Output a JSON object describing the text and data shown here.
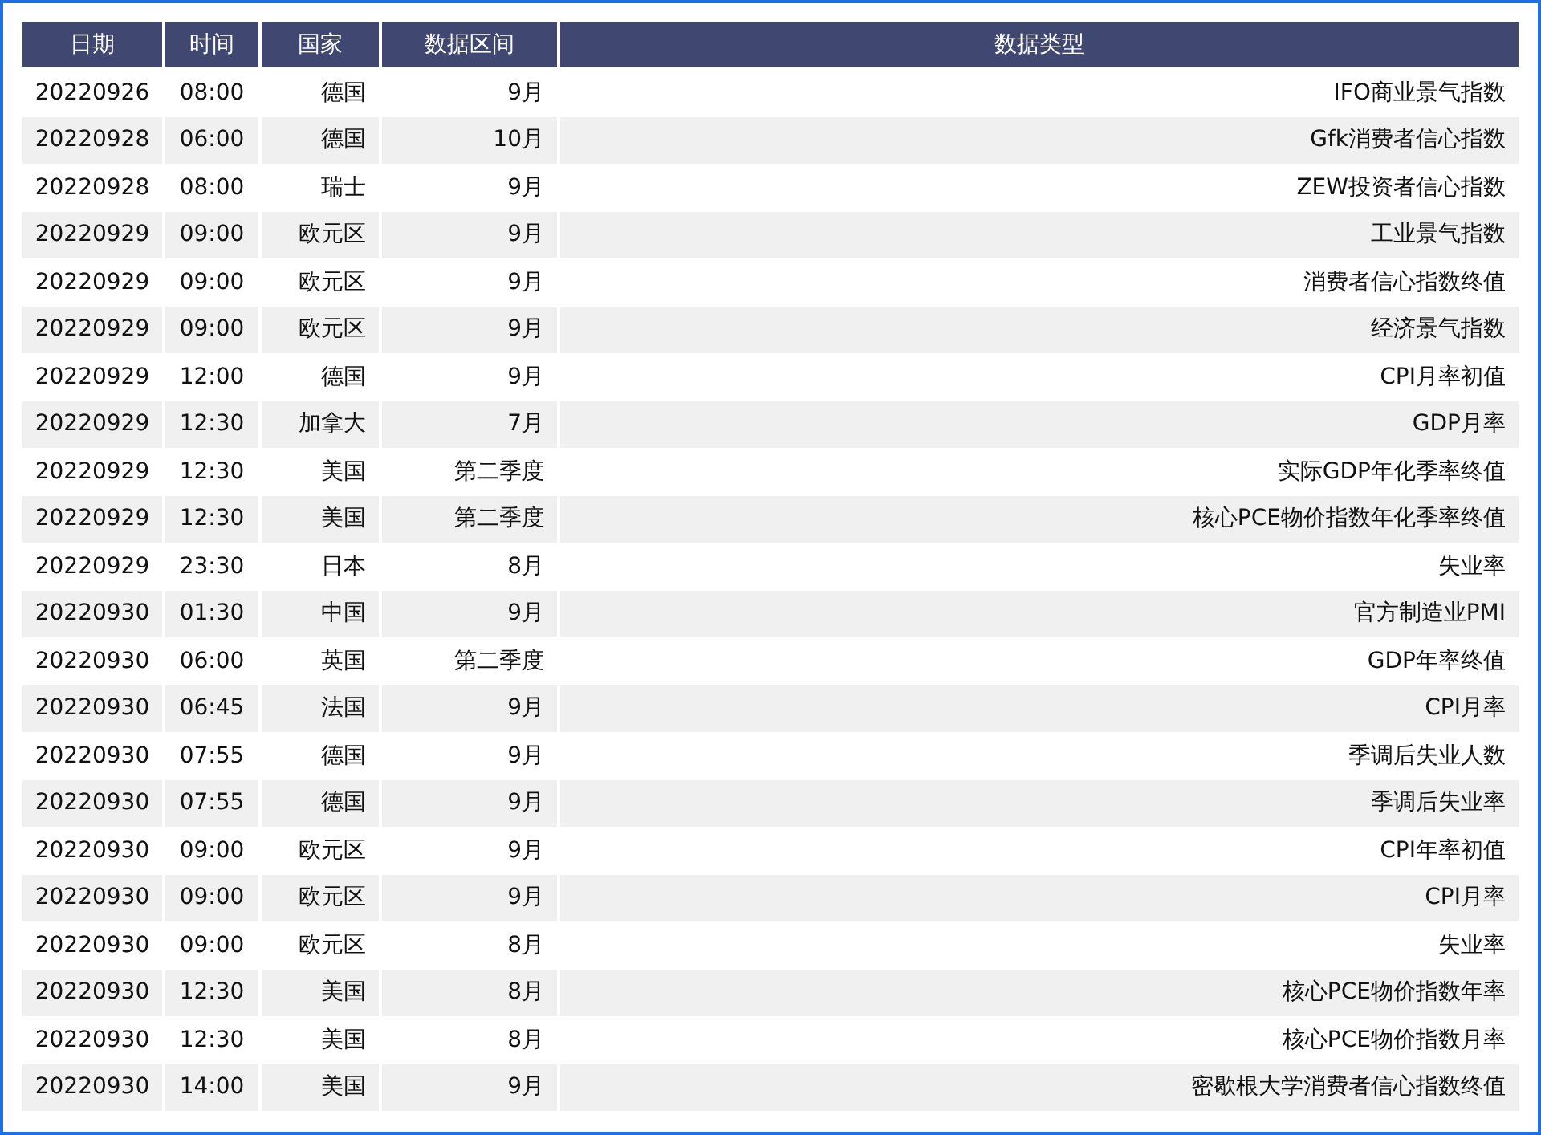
{
  "table": {
    "columns": [
      "日期",
      "时间",
      "国家",
      "数据区间",
      "数据类型"
    ],
    "rows": [
      [
        "20220926",
        "08:00",
        "德国",
        "9月",
        "IFO商业景气指数"
      ],
      [
        "20220928",
        "06:00",
        "德国",
        "10月",
        "Gfk消费者信心指数"
      ],
      [
        "20220928",
        "08:00",
        "瑞士",
        "9月",
        "ZEW投资者信心指数"
      ],
      [
        "20220929",
        "09:00",
        "欧元区",
        "9月",
        "工业景气指数"
      ],
      [
        "20220929",
        "09:00",
        "欧元区",
        "9月",
        "消费者信心指数终值"
      ],
      [
        "20220929",
        "09:00",
        "欧元区",
        "9月",
        "经济景气指数"
      ],
      [
        "20220929",
        "12:00",
        "德国",
        "9月",
        "CPI月率初值"
      ],
      [
        "20220929",
        "12:30",
        "加拿大",
        "7月",
        "GDP月率"
      ],
      [
        "20220929",
        "12:30",
        "美国",
        "第二季度",
        "实际GDP年化季率终值"
      ],
      [
        "20220929",
        "12:30",
        "美国",
        "第二季度",
        "核心PCE物价指数年化季率终值"
      ],
      [
        "20220929",
        "23:30",
        "日本",
        "8月",
        "失业率"
      ],
      [
        "20220930",
        "01:30",
        "中国",
        "9月",
        "官方制造业PMI"
      ],
      [
        "20220930",
        "06:00",
        "英国",
        "第二季度",
        "GDP年率终值"
      ],
      [
        "20220930",
        "06:45",
        "法国",
        "9月",
        "CPI月率"
      ],
      [
        "20220930",
        "07:55",
        "德国",
        "9月",
        "季调后失业人数"
      ],
      [
        "20220930",
        "07:55",
        "德国",
        "9月",
        "季调后失业率"
      ],
      [
        "20220930",
        "09:00",
        "欧元区",
        "9月",
        "CPI年率初值"
      ],
      [
        "20220930",
        "09:00",
        "欧元区",
        "9月",
        "CPI月率"
      ],
      [
        "20220930",
        "09:00",
        "欧元区",
        "8月",
        "失业率"
      ],
      [
        "20220930",
        "12:30",
        "美国",
        "8月",
        "核心PCE物价指数年率"
      ],
      [
        "20220930",
        "12:30",
        "美国",
        "8月",
        "核心PCE物价指数月率"
      ],
      [
        "20220930",
        "14:00",
        "美国",
        "9月",
        "密歇根大学消费者信心指数终值"
      ]
    ]
  }
}
